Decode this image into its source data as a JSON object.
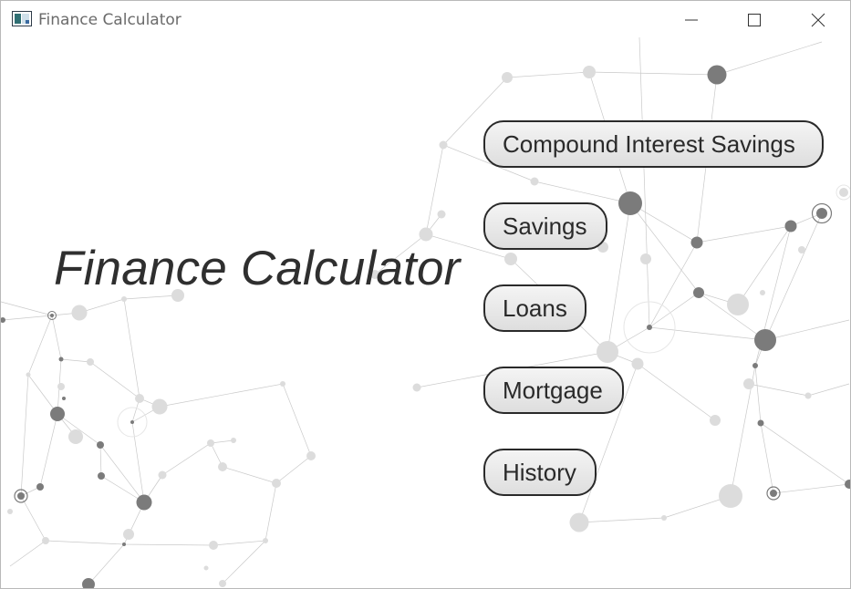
{
  "window": {
    "title": "Finance Calculator"
  },
  "heading": "Finance Calculator",
  "menu": {
    "compound_interest_savings": "Compound Interest Savings",
    "savings": "Savings",
    "loans": "Loans",
    "mortgage": "Mortgage",
    "history": "History"
  },
  "colors": {
    "button_border": "#2a2a2a",
    "button_fill": "#e6e6e6",
    "title_text": "#2f2f2f",
    "node_dark": "#7b7b7b",
    "node_light": "#dddddd"
  }
}
